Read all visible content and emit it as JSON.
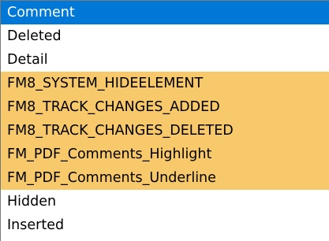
{
  "list": {
    "items": [
      {
        "label": "Comment",
        "state": "selected"
      },
      {
        "label": "Deleted",
        "state": "normal"
      },
      {
        "label": "Detail",
        "state": "normal"
      },
      {
        "label": "FM8_SYSTEM_HIDEELEMENT",
        "state": "highlighted"
      },
      {
        "label": "FM8_TRACK_CHANGES_ADDED",
        "state": "highlighted"
      },
      {
        "label": "FM8_TRACK_CHANGES_DELETED",
        "state": "highlighted"
      },
      {
        "label": "FM_PDF_Comments_Highlight",
        "state": "highlighted"
      },
      {
        "label": "FM_PDF_Comments_Underline",
        "state": "highlighted"
      },
      {
        "label": "Hidden",
        "state": "normal"
      },
      {
        "label": "Inserted",
        "state": "normal"
      }
    ]
  },
  "colors": {
    "selection": "#0078d7",
    "highlight": "#f7c96a",
    "border": "#7a7a7a"
  }
}
